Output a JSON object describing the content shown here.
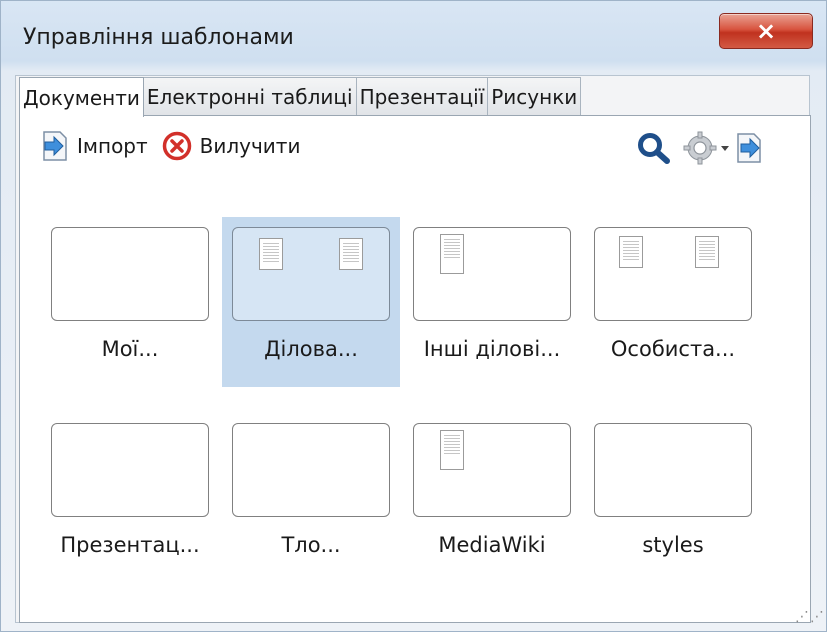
{
  "window": {
    "title": "Управління шаблонами",
    "close_glyph": "×"
  },
  "tabs": [
    {
      "label": "Документи",
      "active": true
    },
    {
      "label": "Електронні таблиці",
      "active": false
    },
    {
      "label": "Презентації",
      "active": false
    },
    {
      "label": "Рисунки",
      "active": false
    }
  ],
  "toolbar": {
    "import_label": "Імпорт",
    "import_icon": "import-arrow-icon",
    "delete_label": "Вилучити",
    "delete_icon": "delete-circle-icon",
    "search_icon": "search-icon",
    "settings_icon": "gear-icon",
    "export_icon": "export-arrow-icon"
  },
  "templates": [
    {
      "label": "Мої...",
      "selected": false
    },
    {
      "label": "Ділова...",
      "selected": true
    },
    {
      "label": "Інші ділові...",
      "selected": false
    },
    {
      "label": "Особиста...",
      "selected": false
    },
    {
      "label": "Презентац...",
      "selected": false
    },
    {
      "label": "Тло...",
      "selected": false
    },
    {
      "label": "MediaWiki",
      "selected": false
    },
    {
      "label": "styles",
      "selected": false
    }
  ],
  "colors": {
    "selection": "#c4d9ee",
    "close_button": "#c9402b",
    "search_icon": "#1f4f8a",
    "delete_icon": "#d2302a"
  }
}
